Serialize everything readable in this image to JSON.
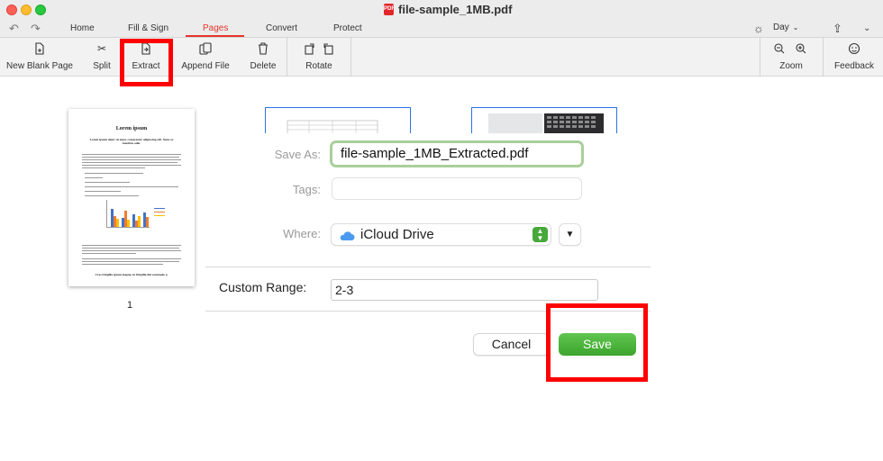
{
  "window": {
    "title": "file-sample_1MB.pdf"
  },
  "menu": {
    "tabs": [
      {
        "label": "Home"
      },
      {
        "label": "Fill & Sign"
      },
      {
        "label": "Pages"
      },
      {
        "label": "Convert"
      },
      {
        "label": "Protect"
      }
    ],
    "active_tab": "Pages",
    "theme_label": "Day"
  },
  "toolbar": {
    "tools": [
      {
        "label": "New Blank Page",
        "icon": "new-page-icon"
      },
      {
        "label": "Split",
        "icon": "scissors-icon"
      },
      {
        "label": "Extract",
        "icon": "extract-icon"
      },
      {
        "label": "Append File",
        "icon": "append-file-icon"
      },
      {
        "label": "Delete",
        "icon": "trash-icon"
      },
      {
        "label": "Rotate",
        "icon": "rotate-icon"
      },
      {
        "label": "Zoom",
        "icon": "zoom-icon"
      },
      {
        "label": "Feedback",
        "icon": "feedback-icon"
      }
    ]
  },
  "thumbnail": {
    "title": "Lorem ipsum",
    "subtitle": "Lorem ipsum dolor sit amet, consectetur adipiscing elit. Nunc ac faucibus odio.",
    "bottom_text": "Cras fringilla ipsum magna, in fringilla dui commodo a.",
    "page_number": "1"
  },
  "dialog": {
    "save_as_label": "Save As:",
    "save_as_value": "file-sample_1MB_Extracted.pdf",
    "tags_label": "Tags:",
    "tags_value": "",
    "where_label": "Where:",
    "where_value": "iCloud Drive",
    "custom_range_label": "Custom Range:",
    "custom_range_value": "2-3",
    "cancel_label": "Cancel",
    "save_label": "Save"
  },
  "colors": {
    "accent": "#e6352a",
    "highlight": "#ff0000",
    "save_button": "#4cb43c"
  }
}
